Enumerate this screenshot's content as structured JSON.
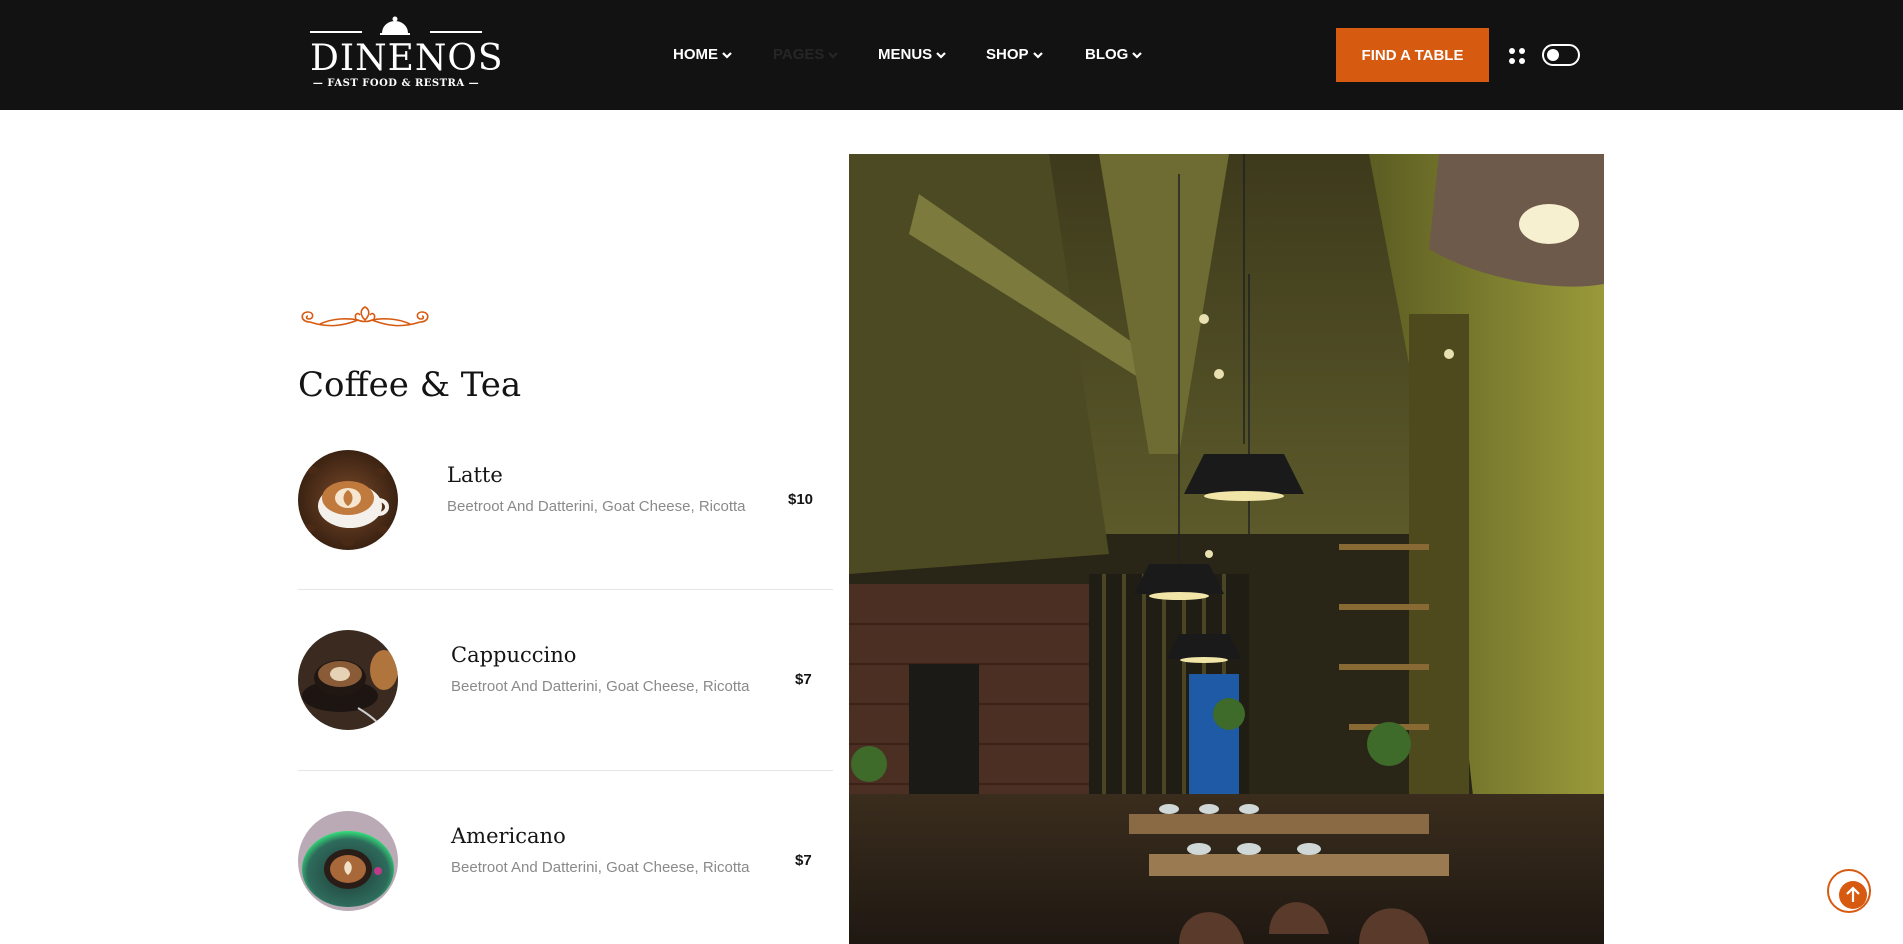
{
  "header": {
    "logo": {
      "brand": "DINENOS",
      "tagline": "FAST FOOD & RESTRA"
    },
    "nav": [
      {
        "label": "HOME"
      },
      {
        "label": "PAGES"
      },
      {
        "label": "MENUS"
      },
      {
        "label": "SHOP"
      },
      {
        "label": "BLOG"
      }
    ],
    "cta_label": "FIND A TABLE"
  },
  "section": {
    "title": "Coffee & Tea",
    "items": [
      {
        "name": "Latte",
        "description": "Beetroot And Datterini, Goat Cheese, Ricotta",
        "price": "$10"
      },
      {
        "name": "Cappuccino",
        "description": "Beetroot And Datterini, Goat Cheese, Ricotta",
        "price": "$7"
      },
      {
        "name": "Americano",
        "description": "Beetroot And Datterini, Goat Cheese, Ricotta",
        "price": "$7"
      }
    ]
  },
  "colors": {
    "accent": "#d75a11",
    "header_bg": "#121212",
    "text": "#141414",
    "muted": "#8a8a8a"
  },
  "icons": [
    "cloche-icon",
    "chevron-down-icon",
    "grid-dots-icon",
    "dark-mode-toggle",
    "ornament-divider",
    "arrow-up-icon"
  ]
}
